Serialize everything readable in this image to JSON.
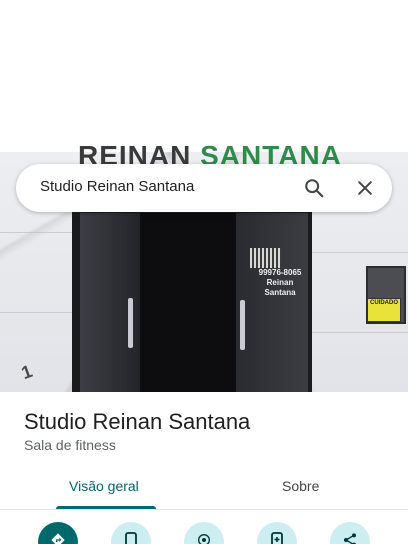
{
  "search": {
    "query": "Studio Reinan Santana",
    "search_icon": "search-icon",
    "close_icon": "close-icon"
  },
  "photo": {
    "sign_text_a": "REINAN",
    "sign_text_b": "SANTANA",
    "door_sticker_phone": "99976-8065",
    "door_sticker_name": "Reinan Santana",
    "warning_sticker": "CUIDADO"
  },
  "place": {
    "title": "Studio Reinan Santana",
    "category": "Sala de fitness"
  },
  "tabs": [
    {
      "label": "Visão geral",
      "active": true
    },
    {
      "label": "Sobre",
      "active": false
    }
  ],
  "actions": [
    {
      "icon": "directions-icon",
      "primary": true
    },
    {
      "icon": "phone-icon",
      "primary": false
    },
    {
      "icon": "location-pin-icon",
      "primary": false
    },
    {
      "icon": "add-to-phone-icon",
      "primary": false
    },
    {
      "icon": "share-icon",
      "primary": false
    }
  ],
  "colors": {
    "accent": "#00696b",
    "accent_light": "#cdeef0",
    "sign_green": "#2e8b4a"
  }
}
